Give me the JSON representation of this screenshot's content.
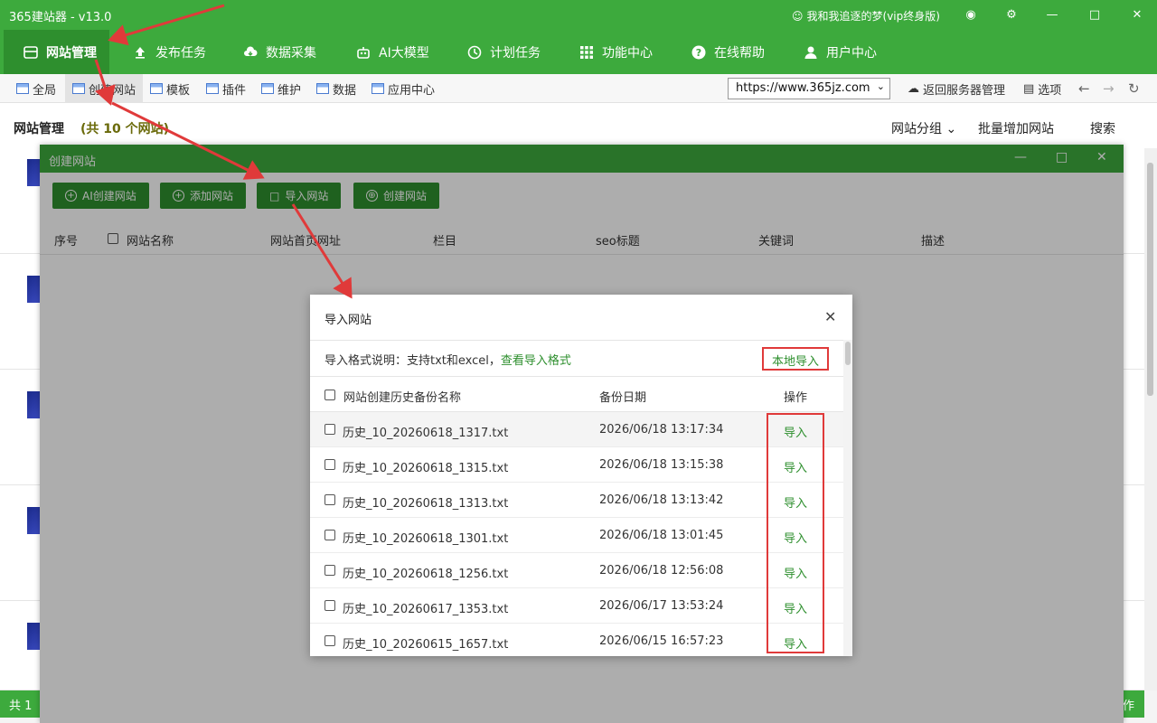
{
  "window": {
    "title": "365建站器 - v13.0",
    "user": "我和我追逐的梦(vip终身版)"
  },
  "nav": [
    {
      "label": "网站管理",
      "icon": "website-manage-icon"
    },
    {
      "label": "发布任务",
      "icon": "upload-icon"
    },
    {
      "label": "数据采集",
      "icon": "cloud-download-icon"
    },
    {
      "label": "AI大模型",
      "icon": "robot-icon"
    },
    {
      "label": "计划任务",
      "icon": "clock-icon"
    },
    {
      "label": "功能中心",
      "icon": "grid-icon"
    },
    {
      "label": "在线帮助",
      "icon": "help-icon"
    },
    {
      "label": "用户中心",
      "icon": "user-icon"
    }
  ],
  "subnav": [
    "全局",
    "创建网站",
    "模板",
    "插件",
    "维护",
    "数据",
    "应用中心"
  ],
  "url_select": "https://www.365jz.com",
  "toolbar_right": {
    "back_server": "返回服务器管理",
    "options": "选项"
  },
  "page": {
    "title": "网站管理",
    "count": "(共 10 个网站)",
    "group": "网站分组",
    "batch_add": "批量增加网站",
    "search": "搜索"
  },
  "footer": {
    "left": "共 1",
    "right": "作"
  },
  "create_window": {
    "title": "创建网站",
    "buttons": [
      "AI创建网站",
      "添加网站",
      "导入网站",
      "创建网站"
    ],
    "columns": [
      "序号",
      "网站名称",
      "网站首页网址",
      "栏目",
      "seo标题",
      "关键词",
      "描述"
    ]
  },
  "import_dialog": {
    "title": "导入网站",
    "info_prefix": "导入格式说明：支持txt和excel，",
    "info_link": "查看导入格式",
    "local_import": "本地导入",
    "columns": {
      "name": "网站创建历史备份名称",
      "date": "备份日期",
      "op": "操作"
    },
    "rows": [
      {
        "name": "历史_10_20260618_1317.txt",
        "date": "2026/06/18 13:17:34",
        "op": "导入"
      },
      {
        "name": "历史_10_20260618_1315.txt",
        "date": "2026/06/18 13:15:38",
        "op": "导入"
      },
      {
        "name": "历史_10_20260618_1313.txt",
        "date": "2026/06/18 13:13:42",
        "op": "导入"
      },
      {
        "name": "历史_10_20260618_1301.txt",
        "date": "2026/06/18 13:01:45",
        "op": "导入"
      },
      {
        "name": "历史_10_20260618_1256.txt",
        "date": "2026/06/18 12:56:08",
        "op": "导入"
      },
      {
        "name": "历史_10_20260617_1353.txt",
        "date": "2026/06/17 13:53:24",
        "op": "导入"
      },
      {
        "name": "历史_10_20260615_1657.txt",
        "date": "2026/06/15 16:57:23",
        "op": "导入"
      }
    ]
  },
  "colors": {
    "brand": "#3daa3d",
    "brand_dark": "#2e8f2e",
    "highlight": "#e03a3a"
  }
}
